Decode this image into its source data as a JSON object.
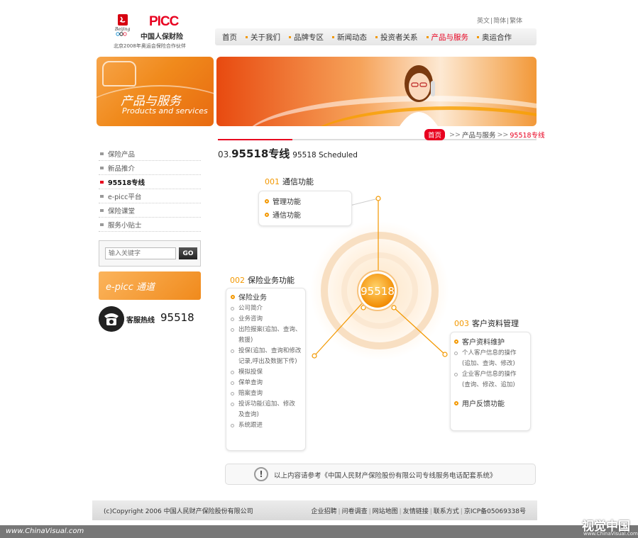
{
  "header": {
    "brand_logo": "PICC",
    "company_name": "中国人保财险",
    "partner_text": "北京2008年奥运会保险合作伙伴",
    "lang": [
      "英文",
      "简体",
      "繁体"
    ],
    "nav": [
      {
        "label": "首页",
        "active": false
      },
      {
        "label": "关于我们",
        "active": false
      },
      {
        "label": "品牌专区",
        "active": false
      },
      {
        "label": "新闻动态",
        "active": false
      },
      {
        "label": "投资者关系",
        "active": false
      },
      {
        "label": "产品与服务",
        "active": true
      },
      {
        "label": "奥运合作",
        "active": false
      }
    ]
  },
  "banner": {
    "title_cn": "产品与服务",
    "title_en": "Products and services"
  },
  "breadcrumb": {
    "home": "首页",
    "section": "产品与服务",
    "current": "95518专线",
    "sep": ">>"
  },
  "page_title": {
    "num": "03.",
    "cn": "95518专线",
    "en": "95518 Scheduled"
  },
  "sidebar": {
    "items": [
      {
        "label": "保险产品",
        "active": false
      },
      {
        "label": "新品推介",
        "active": false
      },
      {
        "label": "95518专线",
        "active": true
      },
      {
        "label": "e-picc平台",
        "active": false
      },
      {
        "label": "保险课堂",
        "active": false
      },
      {
        "label": "服务小贴士",
        "active": false
      }
    ],
    "search_placeholder": "输入关键字",
    "go_label": "GO",
    "epicc_label": "e-picc 通道",
    "hotline_label": "客服热线",
    "hotline_number": "95518"
  },
  "diagram": {
    "center": "95518",
    "sec1": {
      "num": "001",
      "title": "通信功能",
      "items": [
        "管理功能",
        "通信功能"
      ]
    },
    "sec2": {
      "num": "002",
      "title": "保险业务功能",
      "main": "保险业务",
      "items": [
        [
          "公司简介"
        ],
        [
          "业务咨询"
        ],
        [
          "出险报案(追加、查询、",
          "救援)"
        ],
        [
          "投保(追加、查询和修改",
          "记录,呼出及数据下传)"
        ],
        [
          "模拟投保"
        ],
        [
          "保单查询"
        ],
        [
          "赔案查询"
        ],
        [
          "投诉功能(追加、修改",
          "及查询)"
        ],
        [
          "系统跟进"
        ]
      ]
    },
    "sec3": {
      "num": "003",
      "title": "客户资料管理",
      "main1": "客户资料维护",
      "sub": [
        [
          "个人客户信息的操作",
          "(追加、查询、修改)"
        ],
        [
          "企业客户信息的操作",
          "(查询、修改、追加)"
        ]
      ],
      "main2": "用户反馈功能"
    }
  },
  "notice": {
    "icon": "!",
    "text": "以上内容请参考《中国人民财产保险股份有限公司专线服务电话配套系统》"
  },
  "footer": {
    "copyright": "(c)Copyright 2006 中国人民财产保险股份有限公司",
    "links": [
      "企业招聘",
      "问卷调查",
      "网站地图",
      "友情链接",
      "联系方式",
      "京ICP备05069338号"
    ]
  },
  "watermark": {
    "left": "www.ChinaVisual.com",
    "right": "视觉中国",
    "right_sub": "www.ChinaVisual.com"
  },
  "colors": {
    "accent": "#f39800",
    "brand_red": "#e8001f"
  }
}
